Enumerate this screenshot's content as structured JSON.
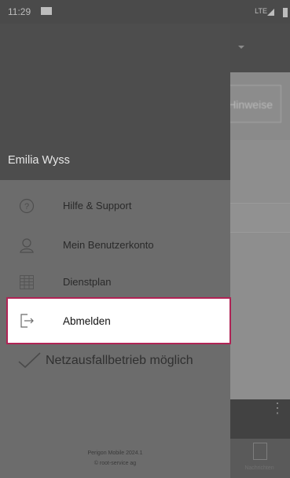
{
  "status_bar": {
    "time": "11:29",
    "network": "LTE"
  },
  "background": {
    "hint_button": "Hinweise",
    "bottom_tab_label": "Nachrichten"
  },
  "drawer": {
    "user_name": "Emilia Wyss",
    "items": [
      {
        "label": "Hilfe & Support",
        "icon": "help-icon"
      },
      {
        "label": "Mein Benutzerkonto",
        "icon": "user-icon"
      },
      {
        "label": "Dienstplan",
        "icon": "calendar-grid-icon"
      },
      {
        "label": "Abmelden",
        "icon": "logout-icon"
      }
    ],
    "offline_mode": "Netzausfallbetrieb möglich",
    "footer": {
      "version": "Perigon Mobile 2024.1",
      "copyright": "© root-service ag"
    }
  },
  "colors": {
    "highlight_border": "#b02355",
    "drawer_header": "#4d4d4d"
  }
}
